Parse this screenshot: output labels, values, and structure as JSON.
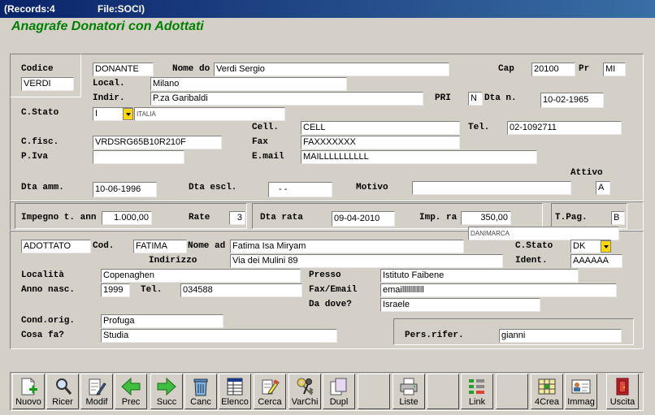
{
  "window": {
    "records": "(Records:4",
    "file": "File:SOCI)",
    "heading": "Anagrafe Donatori con Adottati"
  },
  "donor": {
    "codice_label": "Codice",
    "codice_value": "VERDI",
    "type_value": "DONANTE",
    "nome_label": "Nome do",
    "nome_value": "Verdi Sergio",
    "cap_label": "Cap",
    "cap_value": "20100",
    "pr_label": "Pr",
    "pr_value": "MI",
    "local_label": "Local.",
    "local_value": "Milano",
    "indir_label": "Indir.",
    "indir_value": "P.za Garibaldi",
    "pri_label": "PRI",
    "pri_value": "N",
    "dtan_label": "Dta n.",
    "dtan_value": "10-02-1965",
    "cstato_label": "C.Stato",
    "cstato_value": "I",
    "cstato_desc": "ITALIA",
    "cell_label": "Cell.",
    "cell_value": "CELL",
    "tel_label": "Tel.",
    "tel_value": "02-1092711",
    "cfisc_label": "C.fisc.",
    "cfisc_value": "VRDSRG65B10R210F",
    "fax_label": "Fax",
    "fax_value": "FAXXXXXXX",
    "piva_label": "P.Iva",
    "piva_value": "",
    "email_label": "E.mail",
    "email_value": "MAILLLLLLLLLL",
    "attivo_label": "Attivo",
    "attivo_value": "A",
    "dtaamm_label": "Dta amm.",
    "dtaamm_value": "10-06-1996",
    "dtaescl_label": "Dta escl.",
    "dtaescl_value": " -  - ",
    "motivo_label": "Motivo",
    "motivo_value": ""
  },
  "payment": {
    "impegno_label": "Impegno t. ann",
    "impegno_value": "1.000,00",
    "rate_label": "Rate",
    "rate_value": "3",
    "dtarata_label": "Dta rata",
    "dtarata_value": "09-04-2010",
    "impra_label": "Imp. ra",
    "impra_value": "350,00",
    "tpag_label": "T.Pag.",
    "tpag_value": "B"
  },
  "adopted": {
    "type_value": "ADOTTATO",
    "cod_label": "Cod.",
    "cod_value": "FATIMA",
    "nome_label": "Nome ad",
    "nome_value": "Fatima Isa Miryam",
    "country_desc": "DANIMARCA",
    "cstato_label": "C.Stato",
    "cstato_value": "DK",
    "indirizzo_label": "Indirizzo",
    "indirizzo_value": "Via dei Mulini 89",
    "ident_label": "Ident.",
    "ident_value": "AAAAAA",
    "localita_label": "Località",
    "localita_value": "Copenaghen",
    "presso_label": "Presso",
    "presso_value": "Istituto Faibene",
    "annonasc_label": "Anno nasc.",
    "annonasc_value": "1999",
    "tel_label": "Tel.",
    "tel_value": "034588",
    "faxemail_label": "Fax/Email",
    "faxemail_value": "emailllllllllll",
    "dadove_label": "Da dove?",
    "dadove_value": "Israele",
    "condorig_label": "Cond.orig.",
    "condorig_value": "Profuga",
    "cosafa_label": "Cosa fa?",
    "cosafa_value": "Studia",
    "persrifer_label": "Pers.rifer.",
    "persrifer_value": "gianni"
  },
  "toolbar": {
    "nuovo": "Nuovo",
    "ricer": "Ricer",
    "modif": "Modif",
    "prec": "Prec",
    "succ": "Succ",
    "canc": "Canc",
    "elenco": "Elenco",
    "cerca": "Cerca",
    "varchi": "VarChi",
    "dupl": "Dupl",
    "liste": "Liste",
    "link": "Link",
    "crea4": "4Crea",
    "immag": "Immag",
    "uscita": "Uscita"
  }
}
